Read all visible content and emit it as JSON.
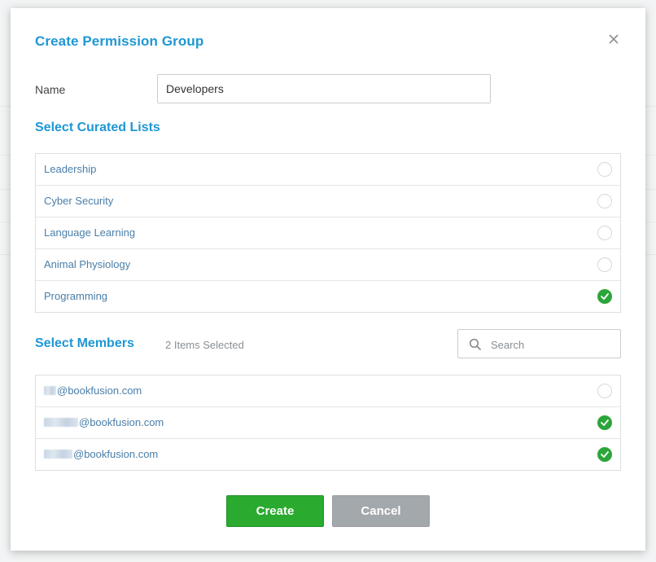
{
  "modal": {
    "title": "Create Permission Group",
    "close_icon": "close-icon"
  },
  "name_field": {
    "label": "Name",
    "value": "Developers"
  },
  "curated_lists": {
    "title": "Select Curated Lists",
    "items": [
      {
        "label": "Leadership",
        "selected": false
      },
      {
        "label": "Cyber Security",
        "selected": false
      },
      {
        "label": "Language Learning",
        "selected": false
      },
      {
        "label": "Animal Physiology",
        "selected": false
      },
      {
        "label": "Programming",
        "selected": true
      }
    ]
  },
  "members": {
    "title": "Select Members",
    "count_label": "2 Items Selected",
    "search_placeholder": "Search",
    "items": [
      {
        "email_domain": "@bookfusion.com",
        "selected": false
      },
      {
        "email_domain": "@bookfusion.com",
        "selected": true
      },
      {
        "email_domain": "@bookfusion.com",
        "selected": true
      }
    ]
  },
  "actions": {
    "create_label": "Create",
    "cancel_label": "Cancel"
  },
  "colors": {
    "accent": "#1e97d4",
    "link_text": "#4a7ea8",
    "selected_green": "#2ca53a",
    "create_button": "#2aaa2e",
    "cancel_button": "#a3a8ad"
  }
}
